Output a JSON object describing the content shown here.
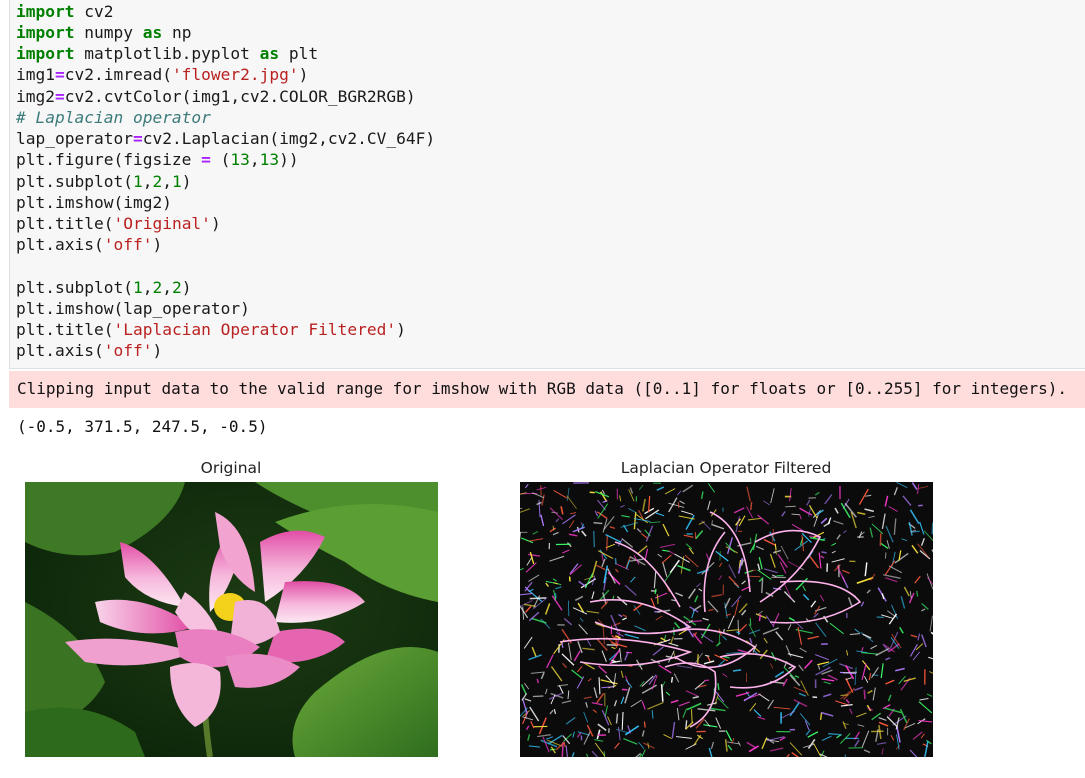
{
  "code_cell": {
    "lines": [
      "import cv2",
      "import numpy as np",
      "import matplotlib.pyplot as plt",
      "img1=cv2.imread('flower2.jpg')",
      "img2=cv2.cvtColor(img1,cv2.COLOR_BGR2RGB)",
      "# Laplacian operator",
      "lap_operator=cv2.Laplacian(img2,cv2.CV_64F)",
      "plt.figure(figsize = (13,13))",
      "plt.subplot(1,2,1)",
      "plt.imshow(img2)",
      "plt.title('Original')",
      "plt.axis('off')",
      "",
      "plt.subplot(1,2,2)",
      "plt.imshow(lap_operator)",
      "plt.title('Laplacian Operator Filtered')",
      "plt.axis('off')"
    ]
  },
  "output": {
    "warning": "Clipping input data to the valid range for imshow with RGB data ([0..1] for floats or [0..255] for integers).",
    "result": "(-0.5, 371.5, 247.5, -0.5)"
  },
  "figure": {
    "left_title": "Original",
    "right_title": "Laplacian Operator Filtered"
  },
  "colors": {
    "code_bg": "#f7f7f7",
    "stderr_bg": "#ffdddd",
    "keyword": "#008000",
    "string": "#ba2121",
    "comment": "#3d7b7b"
  }
}
